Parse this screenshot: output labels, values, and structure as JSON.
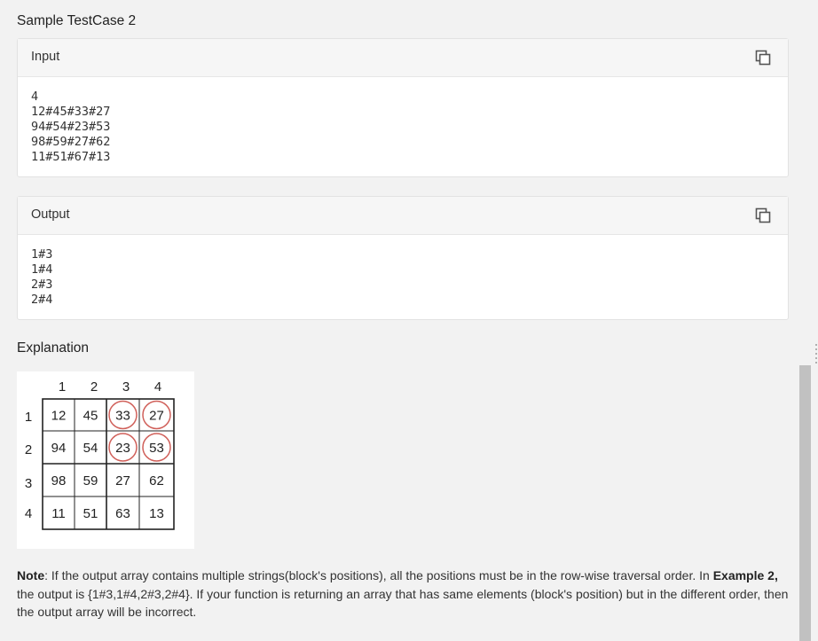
{
  "sample": {
    "title": "Sample TestCase 2"
  },
  "input": {
    "label": "Input",
    "lines": [
      "4",
      "12#45#33#27",
      "94#54#23#53",
      "98#59#27#62",
      "11#51#67#13"
    ]
  },
  "output": {
    "label": "Output",
    "lines": [
      "1#3",
      "1#4",
      "2#3",
      "2#4"
    ]
  },
  "explanation": {
    "title": "Explanation",
    "col_headers": [
      "1",
      "2",
      "3",
      "4"
    ],
    "row_headers": [
      "1",
      "2",
      "3",
      "4"
    ],
    "grid": [
      [
        "12",
        "45",
        "33",
        "27"
      ],
      [
        "94",
        "54",
        "23",
        "53"
      ],
      [
        "98",
        "59",
        "27",
        "62"
      ],
      [
        "11",
        "51",
        "63",
        "13"
      ]
    ],
    "circled": [
      "1#3",
      "1#4",
      "2#3",
      "2#4"
    ]
  },
  "note": {
    "label": "Note",
    "t1": ": If the output array contains multiple strings(block's positions), all the positions must be in the row-wise traversal order. In ",
    "example": "Example 2,",
    "t2": " the output is {1#3,1#4,2#3,2#4}. If your function is returning an array that has same elements (block's position) but in the different order, then the output array will be incorrect."
  },
  "icons": {
    "copy": "copy-icon"
  },
  "colors": {
    "circle": "#d0605a",
    "thumb": "#c1c1c1"
  }
}
